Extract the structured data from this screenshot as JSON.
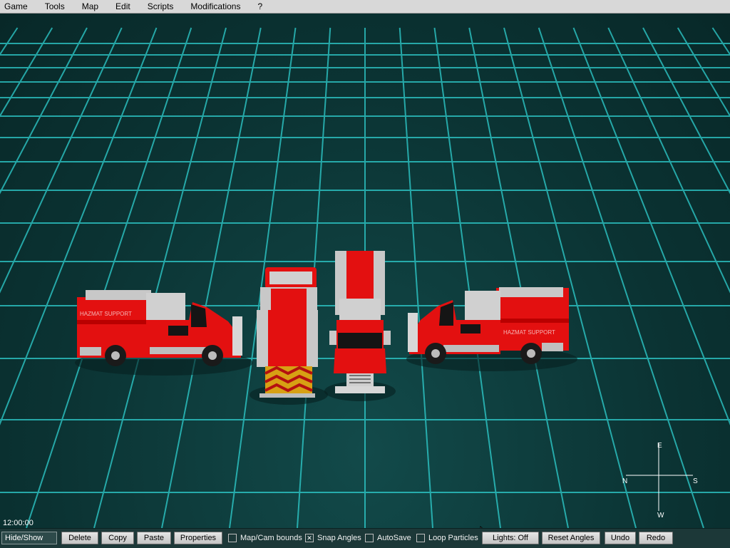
{
  "menu": [
    "Game",
    "Tools",
    "Map",
    "Edit",
    "Scripts",
    "Modifications",
    "?"
  ],
  "clock": "12:00:00",
  "truck_text": {
    "left": "HAZMAT  SUPPORT",
    "right": "HAZMAT  SUPPORT"
  },
  "compass": {
    "n": "N",
    "s": "S",
    "e": "E",
    "w": "W"
  },
  "toolbar": {
    "hide_show": "Hide/Show",
    "delete": "Delete",
    "copy": "Copy",
    "paste": "Paste",
    "properties": "Properties",
    "map_cam_bounds": {
      "label": "Map/Cam bounds",
      "checked": false
    },
    "snap_angles": {
      "label": "Snap Angles",
      "checked": true
    },
    "autosave": {
      "label": "AutoSave",
      "checked": false
    },
    "loop_particles": {
      "label": "Loop Particles",
      "checked": false
    },
    "lights": "Lights: Off",
    "reset_angles": "Reset Angles",
    "undo": "Undo",
    "redo": "Redo"
  },
  "colors": {
    "grid": "#2fd0d0",
    "truck_red": "#e31010",
    "chrome": "#c8c8c8"
  }
}
